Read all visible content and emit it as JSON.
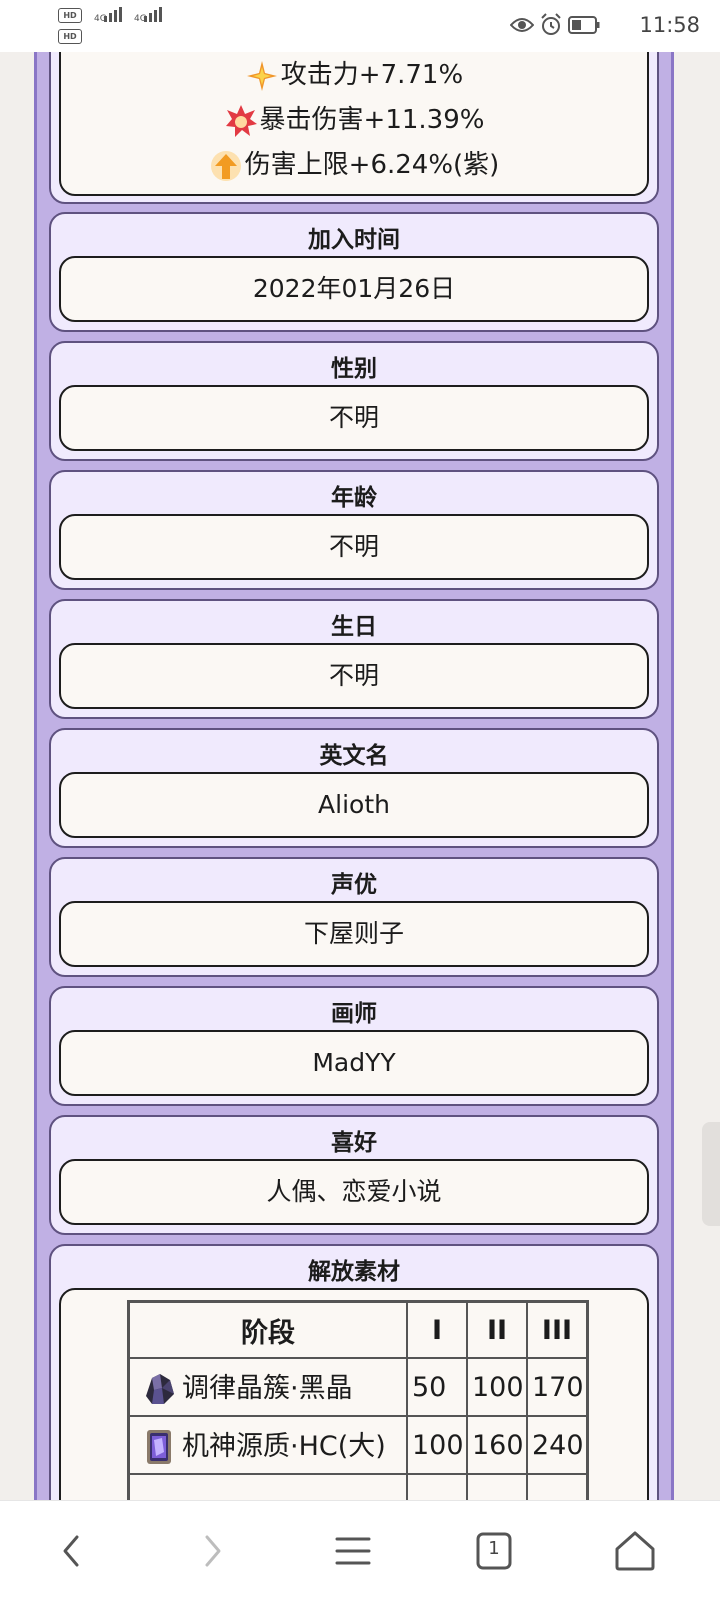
{
  "status_bar": {
    "time": "11:58",
    "hd1": "HD",
    "hd2": "HD",
    "net1": "4G",
    "net2": "4G",
    "icons": [
      "eye-icon",
      "alarm-icon",
      "battery-icon"
    ]
  },
  "attributes": {
    "lines": [
      {
        "text": "攻击力+7.71%",
        "icon": "attack-icon"
      },
      {
        "text": "暴击伤害+11.39%",
        "icon": "crit-damage-icon"
      },
      {
        "text": "伤害上限+6.24%(紫)",
        "icon": "damage-cap-icon"
      }
    ]
  },
  "info_cards": [
    {
      "label": "加入时间",
      "value": "2022年01月26日"
    },
    {
      "label": "性别",
      "value": "不明"
    },
    {
      "label": "年龄",
      "value": "不明"
    },
    {
      "label": "生日",
      "value": "不明"
    },
    {
      "label": "英文名",
      "value": "Alioth"
    },
    {
      "label": "声优",
      "value": "下屋则子"
    },
    {
      "label": "画师",
      "value": "MadYY"
    },
    {
      "label": "喜好",
      "value": "人偶、恋爱小说"
    }
  ],
  "materials": {
    "title": "解放素材",
    "headers": [
      "阶段",
      "I",
      "II",
      "III"
    ],
    "rows": [
      {
        "name": "调律晶簇·黑晶",
        "icon": "black-crystal-icon",
        "values": [
          "50",
          "100",
          "170"
        ]
      },
      {
        "name": "机神源质·HC(大)",
        "icon": "hc-core-icon",
        "values": [
          "100",
          "160",
          "240"
        ]
      }
    ]
  },
  "nav": {
    "tab_count": "1",
    "buttons": [
      "back-icon",
      "forward-icon",
      "menu-icon",
      "tabs-icon",
      "home-icon"
    ]
  },
  "colors": {
    "page_background": "#c0b0e4",
    "card_background": "#f0eafd",
    "inner_background": "#fbf8f4",
    "border": "#5f5280"
  }
}
